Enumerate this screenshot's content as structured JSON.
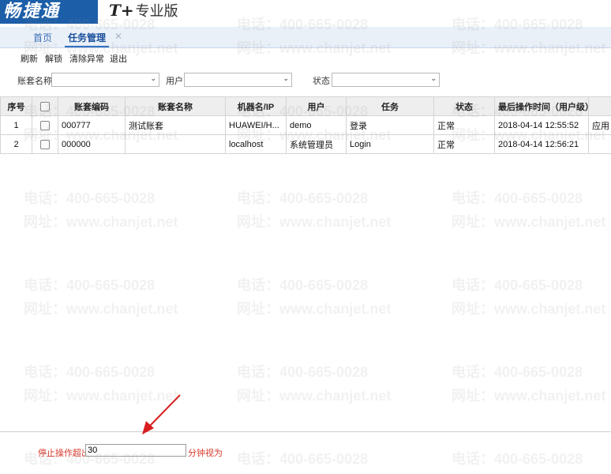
{
  "brand": {
    "logo_text": "畅捷通",
    "product_prefix": "T+",
    "product_name": "专业版"
  },
  "tabs": [
    {
      "label": "首页"
    },
    {
      "label": "任务管理"
    },
    {
      "label": "✕"
    }
  ],
  "toolbar": {
    "refresh": "刷新",
    "unlock": "解锁",
    "clear": "清除异常",
    "exit": "退出"
  },
  "filters": {
    "account_label": "账套名称",
    "user_label": "用户",
    "status_label": "状态",
    "chevron": "⌄"
  },
  "table": {
    "headers": [
      "序号",
      "",
      "账套编码",
      "账套名称",
      "机器名/IP",
      "用户",
      "任务",
      "状态",
      "最后操作时间（用户级）",
      ""
    ],
    "rows": [
      {
        "seq": "1",
        "code": "000777",
        "name": "测试账套",
        "machine": "HUAWEI/H...",
        "user": "demo",
        "task": "登录",
        "status": "正常",
        "time": "2018-04-14 12:55:52",
        "extra": "应用"
      },
      {
        "seq": "2",
        "code": "000000",
        "name": "",
        "machine": "localhost",
        "user": "系统管理员",
        "task": "Login",
        "status": "正常",
        "time": "2018-04-14 12:56:21",
        "extra": ""
      }
    ]
  },
  "footer": {
    "label": "停止操作超出",
    "value": "30",
    "unit": "分钟视为"
  },
  "watermark": {
    "phone": "电话：400-665-0028",
    "site": "网址：www.chanjet.net"
  },
  "colors": {
    "brand_blue": "#1c5ea8",
    "tab_active": "#2f6fc4",
    "footer_red": "#d83a2c",
    "arrow_red": "#d81e1e"
  }
}
